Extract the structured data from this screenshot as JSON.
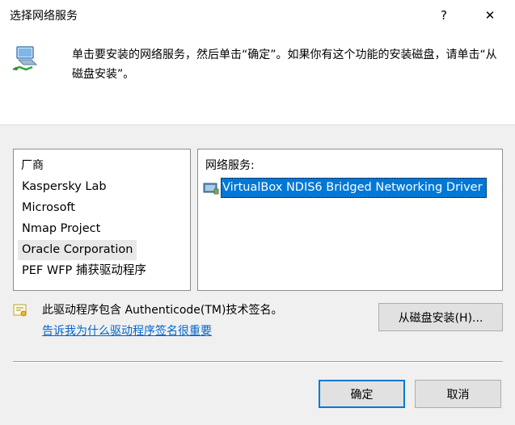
{
  "window": {
    "title": "选择网络服务",
    "help_glyph": "?",
    "close_glyph": "✕"
  },
  "header": {
    "instruction": "单击要安装的网络服务，然后单击“确定”。如果你有这个功能的安装磁盘，请单击“从磁盘安装”。",
    "icon": "network-adapter-icon"
  },
  "manufacturers": {
    "header": "厂商",
    "items": [
      "Kaspersky Lab",
      "Microsoft",
      "Nmap Project",
      "Oracle Corporation",
      "PEF WFP 捕获驱动程序"
    ],
    "selected_index": 3
  },
  "services": {
    "header": "网络服务:",
    "items": [
      "VirtualBox NDIS6 Bridged Networking Driver"
    ],
    "selected_index": 0,
    "icon": "network-service-icon"
  },
  "signature": {
    "text": "此驱动程序包含 Authenticode(TM)技术签名。",
    "link": "告诉我为什么驱动程序签名很重要",
    "icon": "signed-certificate-icon"
  },
  "buttons": {
    "have_disk": "从磁盘安装(H)...",
    "ok": "确定",
    "cancel": "取消"
  },
  "colors": {
    "selection": "#0078d7",
    "link": "#0066cc",
    "dialog_bg": "#f0f0f0"
  }
}
